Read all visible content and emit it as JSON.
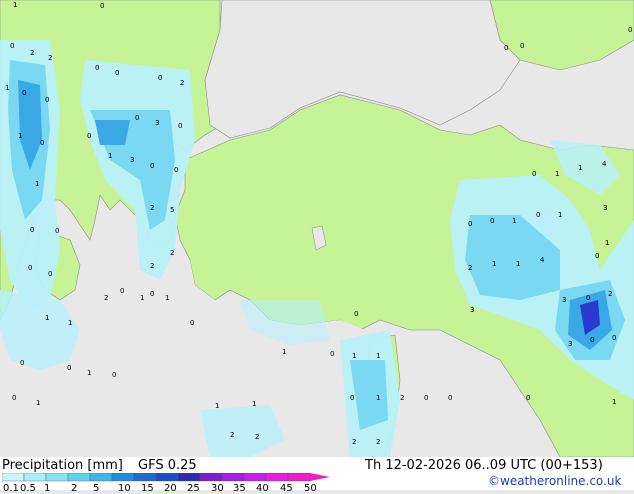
{
  "footer": {
    "title": "Precipitation [mm]",
    "model": "GFS 0.25",
    "datetime": "Th 12-02-2026 06..09 UTC (00+153)",
    "credit": "©weatheronline.co.uk"
  },
  "legend": {
    "ticks": [
      "0.1",
      "0.5",
      "1",
      "2",
      "5",
      "10",
      "15",
      "20",
      "25",
      "30",
      "35",
      "40",
      "45",
      "50"
    ],
    "colors": [
      "#ccf5ff",
      "#a9eefc",
      "#86e3f7",
      "#62d2f2",
      "#3cb9ea",
      "#1e8fe0",
      "#1e6ad2",
      "#1e4cc8",
      "#2a2ab4",
      "#7a1ed2",
      "#a01ee6",
      "#c81ef0",
      "#e61ee6",
      "#f01ec8"
    ]
  },
  "colors": {
    "land": "#c6f396",
    "sea": "#e8e8e8",
    "precip_light": "#b8f0fa",
    "precip_mid": "#7ad8f2",
    "precip_heavy": "#3ba8e6",
    "precip_peak": "#2a3ad0"
  },
  "map_labels": [
    "1",
    "2",
    "0",
    "0",
    "0",
    "0",
    "2",
    "0",
    "2",
    "1",
    "0",
    "0",
    "3",
    "0",
    "0",
    "1",
    "0",
    "0",
    "1",
    "3",
    "0",
    "0",
    "1",
    "2",
    "5",
    "0",
    "0",
    "2",
    "2",
    "0",
    "0",
    "0",
    "0",
    "2",
    "1",
    "1",
    "1",
    "1",
    "0",
    "0",
    "0",
    "1",
    "0",
    "0",
    "1",
    "1",
    "1",
    "1",
    "0",
    "1",
    "1",
    "0",
    "0",
    "0",
    "1",
    "0",
    "1",
    "0",
    "1",
    "1",
    "4",
    "3",
    "3",
    "2",
    "1",
    "1",
    "4",
    "3",
    "0",
    "2",
    "3",
    "0",
    "0",
    "0",
    "1",
    "2",
    "0",
    "0",
    "2",
    "2",
    "2",
    "2",
    "0",
    "0",
    "0",
    "1",
    "0",
    "1",
    "0"
  ]
}
